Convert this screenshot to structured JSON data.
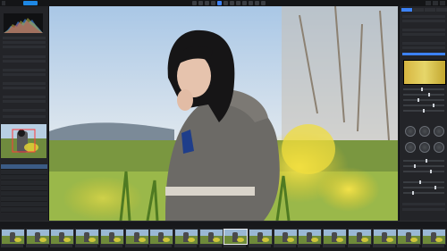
{
  "topbar": {
    "app_title": "",
    "active_tab": "",
    "tool_icons": [
      "cursor-tool-icon",
      "crop-tool-icon",
      "rotate-tool-icon",
      "brush-tool-icon",
      "eraser-tool-icon",
      "gradient-tool-icon",
      "clone-tool-icon",
      "eyedropper-tool-icon",
      "zoom-tool-icon",
      "hand-tool-icon",
      "compare-tool-icon",
      "grid-tool-icon"
    ]
  },
  "statusbar": {
    "center_label": "",
    "info": ""
  },
  "filmstrip": {
    "count": 18,
    "selected_index": 9
  },
  "colors": {
    "accent": "#3c82f6",
    "panel_bg": "#232428",
    "window_bg": "#1e1f22"
  }
}
